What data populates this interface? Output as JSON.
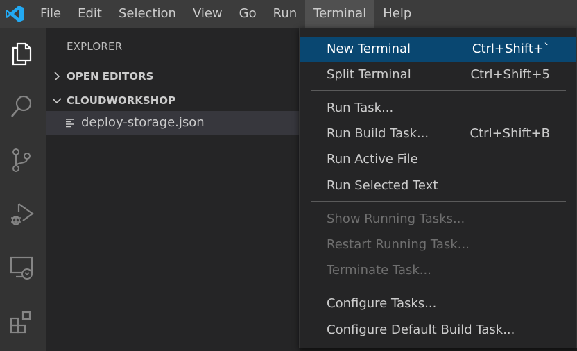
{
  "menubar": {
    "items": [
      "File",
      "Edit",
      "Selection",
      "View",
      "Go",
      "Run",
      "Terminal",
      "Help"
    ],
    "active": "Terminal"
  },
  "sidebar": {
    "title": "EXPLORER",
    "sections": [
      {
        "label": "OPEN EDITORS",
        "expanded": false
      },
      {
        "label": "CLOUDWORKSHOP",
        "expanded": true
      }
    ],
    "files": [
      {
        "name": "deploy-storage.json"
      }
    ]
  },
  "activitybar": {
    "icons": [
      "explorer-icon",
      "search-icon",
      "source-control-icon",
      "run-debug-icon",
      "remote-explorer-icon",
      "extensions-icon"
    ]
  },
  "terminal_menu": {
    "items": [
      {
        "label": "New Terminal",
        "shortcut": "Ctrl+Shift+`",
        "state": "selected"
      },
      {
        "label": "Split Terminal",
        "shortcut": "Ctrl+Shift+5",
        "state": "enabled"
      },
      {
        "label": "Run Task...",
        "shortcut": "",
        "state": "enabled"
      },
      {
        "label": "Run Build Task...",
        "shortcut": "Ctrl+Shift+B",
        "state": "enabled"
      },
      {
        "label": "Run Active File",
        "shortcut": "",
        "state": "enabled"
      },
      {
        "label": "Run Selected Text",
        "shortcut": "",
        "state": "enabled"
      },
      {
        "label": "Show Running Tasks...",
        "shortcut": "",
        "state": "disabled"
      },
      {
        "label": "Restart Running Task...",
        "shortcut": "",
        "state": "disabled"
      },
      {
        "label": "Terminate Task...",
        "shortcut": "",
        "state": "disabled"
      },
      {
        "label": "Configure Tasks...",
        "shortcut": "",
        "state": "enabled"
      },
      {
        "label": "Configure Default Build Task...",
        "shortcut": "",
        "state": "enabled"
      }
    ]
  },
  "colors": {
    "accent_blue": "#23a9f2",
    "selection": "#094771",
    "titlebar": "#3c3c3c",
    "sidebar": "#252526",
    "activitybar": "#333333"
  }
}
